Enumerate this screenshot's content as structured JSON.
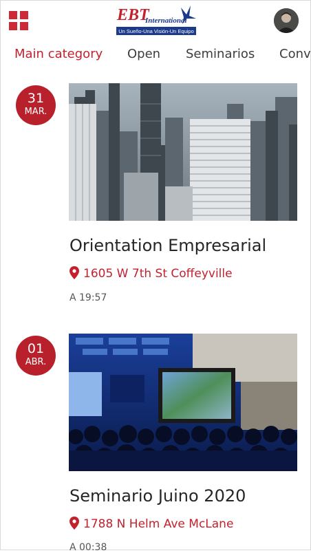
{
  "header": {
    "menu_icon": "grid-icon",
    "logo": {
      "title": "EBT International",
      "tagline": "Un Sueño-Una Visión-Un Equipo"
    },
    "avatar_icon": "user-avatar"
  },
  "tabs": [
    {
      "label": "Main category",
      "active": true
    },
    {
      "label": "Open",
      "active": false
    },
    {
      "label": "Seminarios",
      "active": false
    },
    {
      "label": "Conv",
      "active": false
    }
  ],
  "events": [
    {
      "day": "31",
      "month": "MAR.",
      "title": "Orientation Empresarial",
      "location": "1605 W 7th St Coffeyville",
      "time": "A 19:57",
      "image": "city skyline"
    },
    {
      "day": "01",
      "month": "ABR.",
      "title": "Seminario Juino 2020",
      "location": "1788 N Helm Ave McLane",
      "time": "A 00:38",
      "image": "conference audience"
    }
  ],
  "colors": {
    "accent": "#c4212d",
    "badge": "#b8202b",
    "logo_blue": "#1b3a8c"
  }
}
